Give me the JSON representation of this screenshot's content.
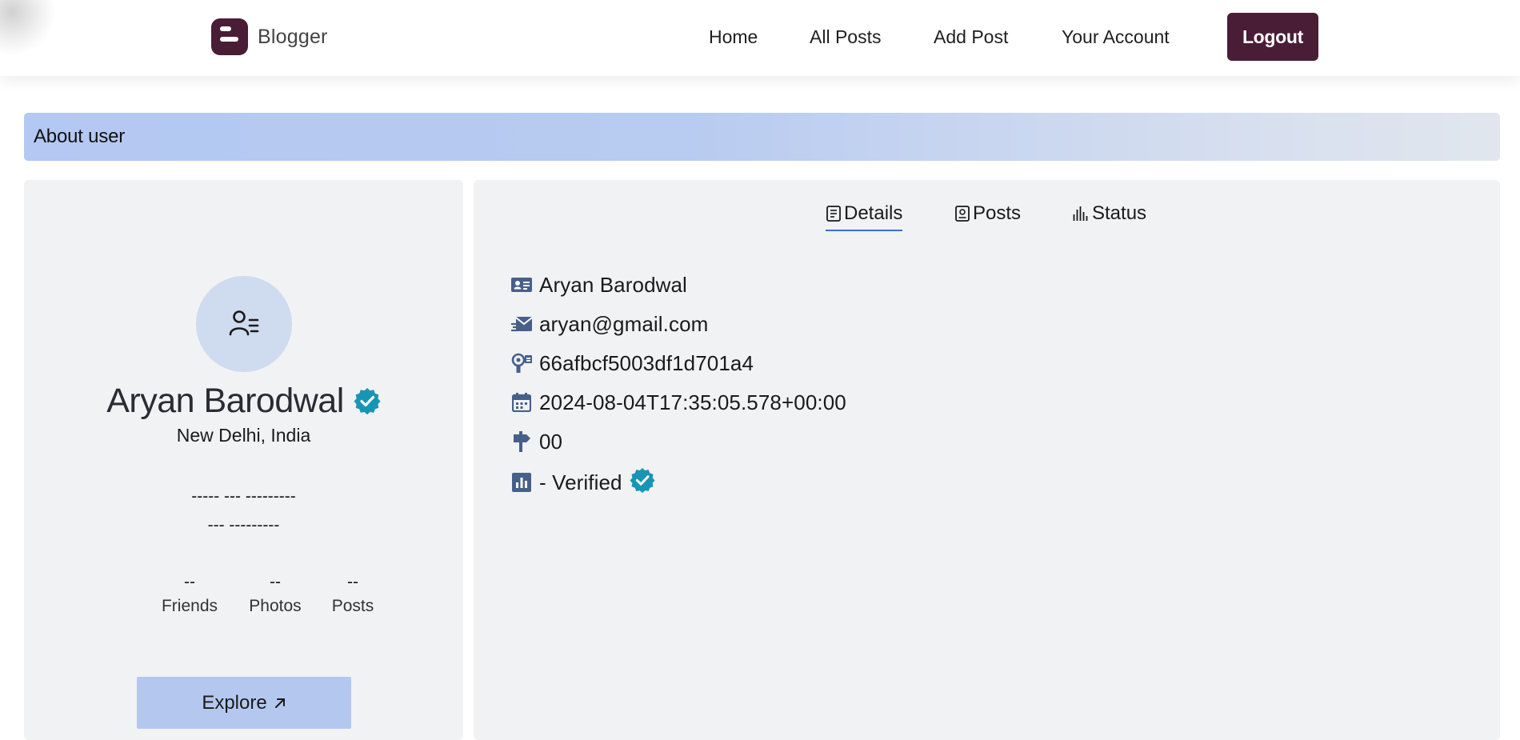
{
  "header": {
    "brand_name": "Blogger",
    "brand_color": "#4a1d36",
    "nav": [
      {
        "label": "Home"
      },
      {
        "label": "All Posts"
      },
      {
        "label": "Add Post"
      },
      {
        "label": "Your Account"
      }
    ],
    "logout_label": "Logout"
  },
  "about": {
    "title": "About user"
  },
  "profile": {
    "avatar_icon": "user-list-icon",
    "name": "Aryan Barodwal",
    "verified_icon": "verified-badge-icon",
    "location": "New Delhi, India",
    "bio_line1": "----- --- ---------",
    "bio_line2": "--- ---------",
    "stats": [
      {
        "value": "--",
        "label": "Friends"
      },
      {
        "value": "--",
        "label": "Photos"
      },
      {
        "value": "--",
        "label": "Posts"
      }
    ],
    "explore_label": "Explore",
    "explore_icon": "arrow-up-right-icon"
  },
  "tabs": [
    {
      "label": "Details",
      "icon": "document-icon",
      "active": true
    },
    {
      "label": "Posts",
      "icon": "portrait-icon",
      "active": false
    },
    {
      "label": "Status",
      "icon": "bar-chart-icon",
      "active": false
    }
  ],
  "details": {
    "name": "Aryan Barodwal",
    "email": "aryan@gmail.com",
    "user_id": "66afbcf5003df1d701a4",
    "created_at": "2024-08-04T17:35:05.578+00:00",
    "posts_count": "00",
    "status": "- Verified"
  },
  "colors": {
    "accent": "#3b6fd6",
    "icon": "#46608a",
    "verified": "#1795b5",
    "card_bg": "#f1f2f4",
    "explore_bg": "#b4c8ef"
  }
}
